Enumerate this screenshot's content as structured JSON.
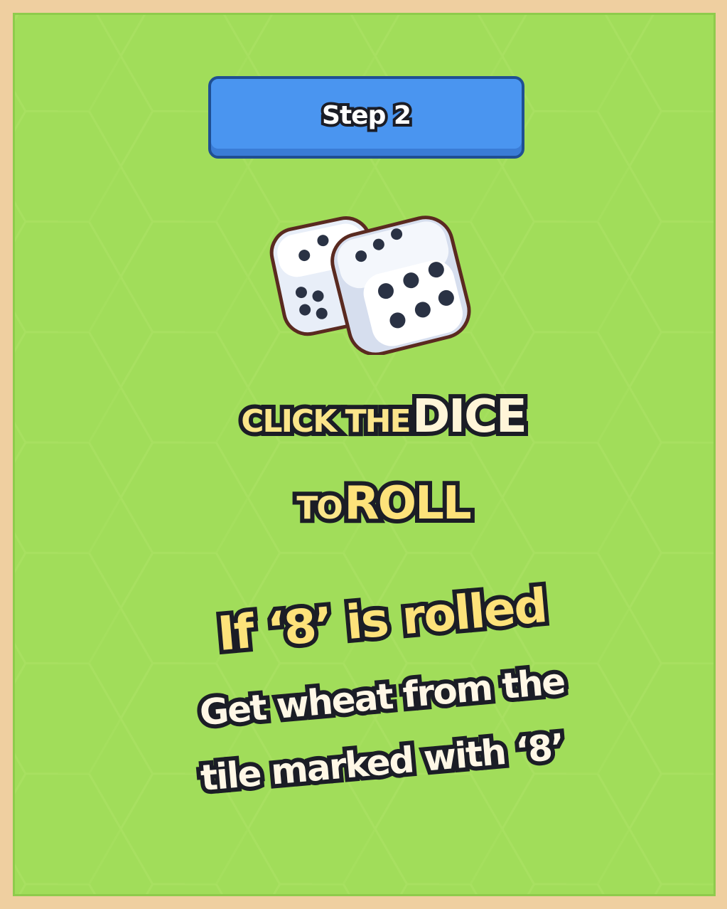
{
  "step": {
    "label": "Step 2"
  },
  "dice": {
    "name": "dice-icon"
  },
  "instruction": {
    "line1_small": "CLICK THE",
    "line1_big": "DICE",
    "line2_small": "TO",
    "line2_big": "ROLL"
  },
  "condition": {
    "headline": "If ‘8’ is rolled",
    "detail_line1": "Get wheat from the",
    "detail_line2": "tile marked with ‘8’"
  },
  "colors": {
    "background": "#a1dd5a",
    "frame": "#efcfa0",
    "button": "#4a95f0",
    "outline": "#1b1d26",
    "accent_yellow": "#fde27a"
  }
}
